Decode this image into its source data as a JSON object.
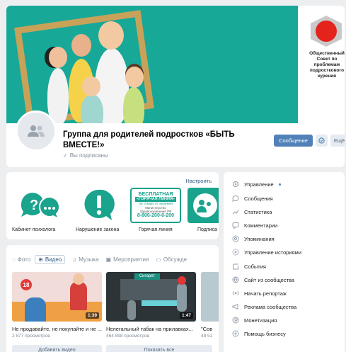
{
  "header": {
    "logo_caption": "Общественный Совет по проблемам подросткового курения",
    "title": "Группа для родителей подростков «БЫТЬ ВМЕСТЕ!»",
    "subscribe_status": "Вы подписаны",
    "message_button": "Сообщение",
    "more_button": "Ещё"
  },
  "apps": {
    "setup_link": "Настроить",
    "items": [
      {
        "label": "Кабинет психолога",
        "icon": "chat-bubbles-icon"
      },
      {
        "label": "Нарушение закона",
        "icon": "exclamation-icon"
      },
      {
        "label": "Горячая линия",
        "icon": "hotline-banner"
      },
      {
        "label": "Подписа",
        "icon": "people-icon"
      }
    ],
    "hotline_banner": {
      "line1": "БЕСПЛАТНАЯ",
      "line2": "«ГОРЯЧАЯ ЛИНИЯ»",
      "line3": "по отказу от курения",
      "line4": "Министерство",
      "line5": "Здравоохранения РФ",
      "phone": "8-800-200-0-200"
    }
  },
  "media": {
    "tabs": [
      {
        "label": "Фото",
        "icon": "photo-icon"
      },
      {
        "label": "Видео",
        "icon": "video-icon"
      },
      {
        "label": "Музыка",
        "icon": "music-icon"
      },
      {
        "label": "Мероприятия",
        "icon": "calendar-icon"
      },
      {
        "label": "Обсужде",
        "icon": "discussion-icon"
      }
    ],
    "videos": [
      {
        "title": "Не продавайте, не покупайте и не ...",
        "views": "2 877 просмотров",
        "duration": "1:39"
      },
      {
        "title": "Нелегальный табак на прилавках...",
        "views": "464 898 просмотров",
        "duration": "1:47"
      },
      {
        "title": "\"Сов",
        "views": "48 51",
        "duration": ""
      }
    ],
    "add_video_button": "Добавить видео",
    "show_all_button": "Показать все",
    "thumb_text_1": "18",
    "thumb_text_2": "Сигарет"
  },
  "menu": {
    "items": [
      {
        "label": "Управление",
        "icon": "gear-icon"
      },
      {
        "label": "Сообщения",
        "icon": "message-icon"
      },
      {
        "label": "Статистика",
        "icon": "stats-icon"
      },
      {
        "label": "Комментарии",
        "icon": "comment-icon"
      },
      {
        "label": "Упоминания",
        "icon": "at-icon"
      },
      {
        "label": "Управление историями",
        "icon": "stories-icon"
      },
      {
        "label": "События",
        "icon": "events-icon"
      },
      {
        "label": "Сайт из сообщества",
        "icon": "globe-icon"
      },
      {
        "label": "Начать репортаж",
        "icon": "broadcast-icon"
      },
      {
        "label": "Реклама сообщества",
        "icon": "megaphone-icon"
      },
      {
        "label": "Монетизация",
        "icon": "coin-icon"
      },
      {
        "label": "Помощь бизнесу",
        "icon": "business-icon"
      }
    ]
  },
  "colors": {
    "accent": "#5181b8",
    "cover_bg": "#17a898",
    "tile_green": "#1aa38d"
  }
}
